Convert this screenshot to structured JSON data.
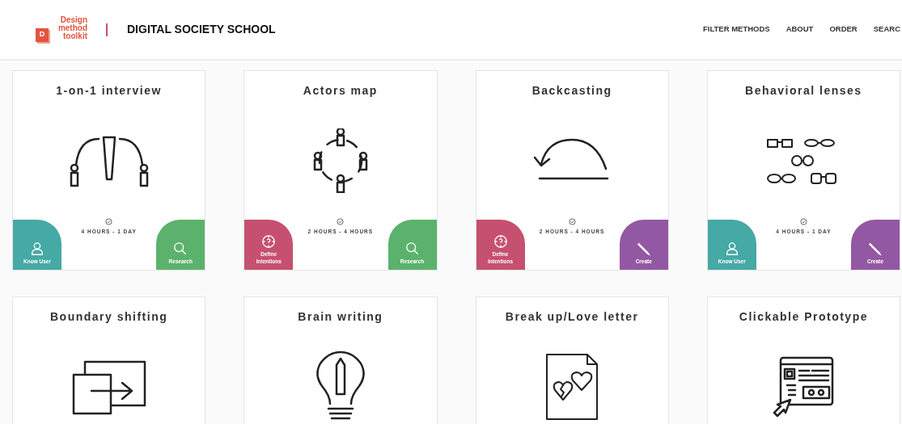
{
  "header": {
    "logo_text": "Design method toolkit",
    "logo_letter": "D",
    "site_title": "DIGITAL SOCIETY SCHOOL",
    "nav": [
      "FILTER METHODS",
      "ABOUT",
      "ORDER",
      "SEARC"
    ]
  },
  "methods": [
    {
      "title": "1-on-1 interview",
      "kind": "interview",
      "duration": "4 HOURS - 1 DAY",
      "tags": [
        {
          "label": "Know User",
          "kind": "person",
          "color": "#45a9a5"
        },
        {
          "label": "Research",
          "kind": "search",
          "color": "#5bb26c"
        }
      ]
    },
    {
      "title": "Actors map",
      "kind": "actors",
      "duration": "2 HOURS - 4 HOURS",
      "tags": [
        {
          "label": "Define Intentions",
          "kind": "compass",
          "color": "#c6506f"
        },
        {
          "label": "Research",
          "kind": "search",
          "color": "#5bb26c"
        }
      ]
    },
    {
      "title": "Backcasting",
      "kind": "backcasting",
      "duration": "2 HOURS - 4 HOURS",
      "tags": [
        {
          "label": "Define Intentions",
          "kind": "compass",
          "color": "#c6506f"
        },
        {
          "label": "Create",
          "kind": "pencil",
          "color": "#9358a3"
        }
      ]
    },
    {
      "title": "Behavioral lenses",
      "kind": "lenses",
      "duration": "4 HOURS - 1 DAY",
      "tags": [
        {
          "label": "Know User",
          "kind": "person",
          "color": "#45a9a5"
        },
        {
          "label": "Create",
          "kind": "pencil",
          "color": "#9358a3"
        }
      ]
    },
    {
      "title": "Boundary shifting",
      "kind": "boundary"
    },
    {
      "title": "Brain writing",
      "kind": "brain"
    },
    {
      "title": "Break up/Love letter",
      "kind": "letter"
    },
    {
      "title": "Clickable Prototype",
      "kind": "prototype"
    }
  ]
}
